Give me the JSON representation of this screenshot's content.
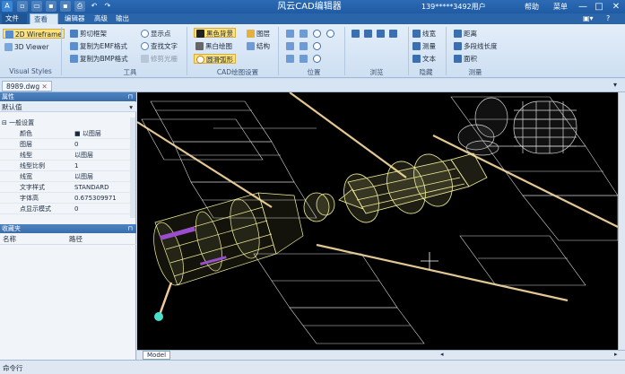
{
  "titlebar": {
    "title": "风云CAD编辑器",
    "user": "139*****3492用户",
    "help": "帮助",
    "menu": "菜单"
  },
  "tabs": [
    "文件",
    "查看器",
    "编辑器",
    "高级",
    "输出"
  ],
  "active_tab": 1,
  "ribbon": {
    "visual_styles": {
      "label": "Visual Styles",
      "items": [
        "2D Wireframe",
        "3D Viewer"
      ]
    },
    "tools": {
      "label": "工具",
      "items": [
        "剪切框架",
        "复制为EMF格式",
        "复制为BMP格式",
        "显示点",
        "查找文字",
        "修剪光栅"
      ]
    },
    "cad_settings": {
      "label": "CAD绘图设置",
      "items": [
        "黑色背景",
        "黑白绘图",
        "圆滑弧形",
        "图层",
        "结构"
      ]
    },
    "position": {
      "label": "位置"
    },
    "browse": {
      "label": "浏览"
    },
    "hide": {
      "label": "隐藏",
      "items": [
        "线宽",
        "测量",
        "文本"
      ]
    },
    "measure": {
      "label": "测量",
      "items": [
        "距离",
        "多段线长度",
        "面积"
      ]
    }
  },
  "document_tab": "8989.dwg",
  "properties": {
    "header": "属性",
    "default_value": "默认值",
    "section": "一般设置",
    "rows": [
      {
        "k": "颜色",
        "v": "■ 以图层"
      },
      {
        "k": "图层",
        "v": "0"
      },
      {
        "k": "线型",
        "v": "以图层"
      },
      {
        "k": "线型比例",
        "v": "1"
      },
      {
        "k": "线宽",
        "v": "以图层"
      },
      {
        "k": "文字样式",
        "v": "STANDARD"
      },
      {
        "k": "字体高",
        "v": "0.675309971"
      },
      {
        "k": "点显示模式",
        "v": "0"
      }
    ]
  },
  "favorites": {
    "header": "收藏夹",
    "col_name": "名称",
    "col_path": "路径"
  },
  "model_tab": "Model",
  "command_label": "命令行",
  "colors": {
    "ribbon": "#dce9f7",
    "title": "#2060a8",
    "canvas": "#000000",
    "wire": "#f2ef9a",
    "white_wire": "#d8d8d8",
    "accent": "#ffe27a"
  }
}
